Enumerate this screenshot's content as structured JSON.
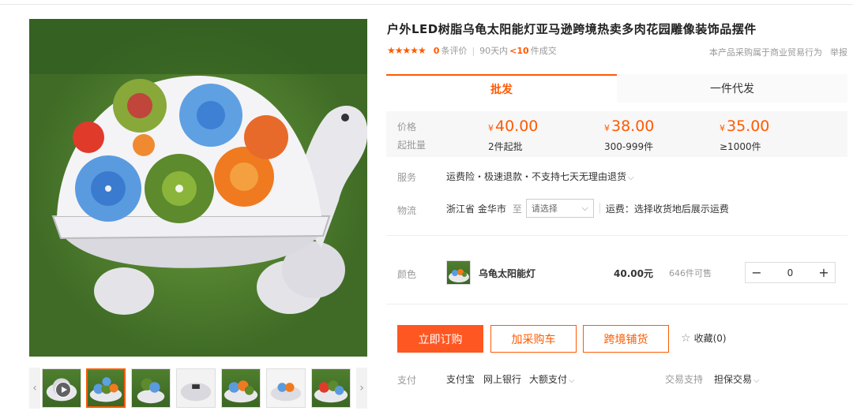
{
  "product": {
    "title": "户外LED树脂乌龟太阳能灯亚马逊跨境热卖多肉花园雕像装饰品摆件",
    "stars": "★★★★★",
    "review_count": "0",
    "review_label": "条评价",
    "days_label": "90天内",
    "sold_count": "<10",
    "sold_label": "件成交",
    "note": "本产品采购属于商业贸易行为",
    "report": "举报"
  },
  "tabs": [
    {
      "label": "批发"
    },
    {
      "label": "一件代发"
    }
  ],
  "price_box": {
    "price_label": "价格",
    "min_label": "起批量",
    "currency": "¥",
    "tiers": [
      {
        "price": "40.00",
        "qty": "2件起批"
      },
      {
        "price": "38.00",
        "qty": "300-999件"
      },
      {
        "price": "35.00",
        "qty": "≥1000件"
      }
    ]
  },
  "service": {
    "label": "服务",
    "text": "运费险・极速退款・不支持七天无理由退货"
  },
  "logistics": {
    "label": "物流",
    "origin": "浙江省 金华市",
    "to": "至",
    "select_value": "请选择",
    "fee_text": "运费：选择收货地后展示运费"
  },
  "sku": {
    "label": "颜色",
    "name": "乌龟太阳能灯",
    "price": "40.00元",
    "stock": "646件可售",
    "minus": "−",
    "plus": "+",
    "quantity": "0"
  },
  "actions": {
    "buy": "立即订购",
    "cart": "加采购车",
    "cross": "跨境铺货",
    "favorite": "收藏(0)"
  },
  "payment": {
    "label": "支付",
    "methods": [
      "支付宝",
      "网上银行",
      "大额支付"
    ],
    "support_label": "交易支持",
    "support_value": "担保交易"
  },
  "gallery": {
    "prev": "‹",
    "next": "›"
  },
  "colors": {
    "accent": "#ff5a00",
    "buy_button": "#ff5722"
  }
}
